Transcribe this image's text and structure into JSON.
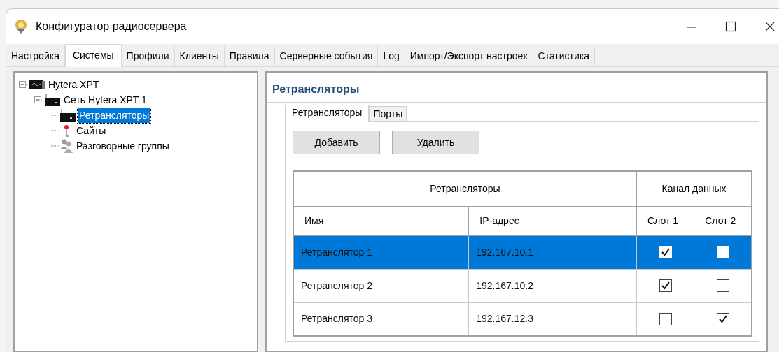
{
  "window": {
    "title": "Конфигуратор радиосервера"
  },
  "tabs": [
    {
      "label": "Настройка",
      "selected": false
    },
    {
      "label": "Системы",
      "selected": true
    },
    {
      "label": "Профили",
      "selected": false
    },
    {
      "label": "Клиенты",
      "selected": false
    },
    {
      "label": "Правила",
      "selected": false
    },
    {
      "label": "Серверные события",
      "selected": false
    },
    {
      "label": "Log",
      "selected": false
    },
    {
      "label": "Импорт/Экспорт настроек",
      "selected": false
    },
    {
      "label": "Статистика",
      "selected": false
    }
  ],
  "tree": [
    {
      "label": "Hytera XPT",
      "kind": "system",
      "selected": false,
      "expanded": true,
      "children": [
        {
          "label": "Сеть Hytera XPT 1",
          "kind": "network",
          "selected": false,
          "expanded": true,
          "children": [
            {
              "label": "Ретрансляторы",
              "kind": "repeater",
              "selected": true
            },
            {
              "label": "Сайты",
              "kind": "site",
              "selected": false
            },
            {
              "label": "Разговорные группы",
              "kind": "group",
              "selected": false
            }
          ]
        }
      ]
    }
  ],
  "panel": {
    "title": "Ретрансляторы",
    "tabs": [
      {
        "label": "Ретрансляторы",
        "selected": true
      },
      {
        "label": "Порты",
        "selected": false
      }
    ],
    "buttons": [
      "Добавить",
      "Удалить"
    ],
    "table": {
      "group_headers": [
        "Ретрансляторы",
        "Канал данных"
      ],
      "columns": [
        "Имя",
        "IP-адрес",
        "Слот 1",
        "Слот 2"
      ],
      "rows": [
        {
          "name": "Ретранслятор 1",
          "ip": "192.167.10.1",
          "slot1": true,
          "slot2": false,
          "selected": true
        },
        {
          "name": "Ретранслятор 2",
          "ip": "192.167.10.2",
          "slot1": true,
          "slot2": false,
          "selected": false
        },
        {
          "name": "Ретранслятор 3",
          "ip": "192.167.12.3",
          "slot1": false,
          "slot2": true,
          "selected": false
        }
      ]
    }
  }
}
